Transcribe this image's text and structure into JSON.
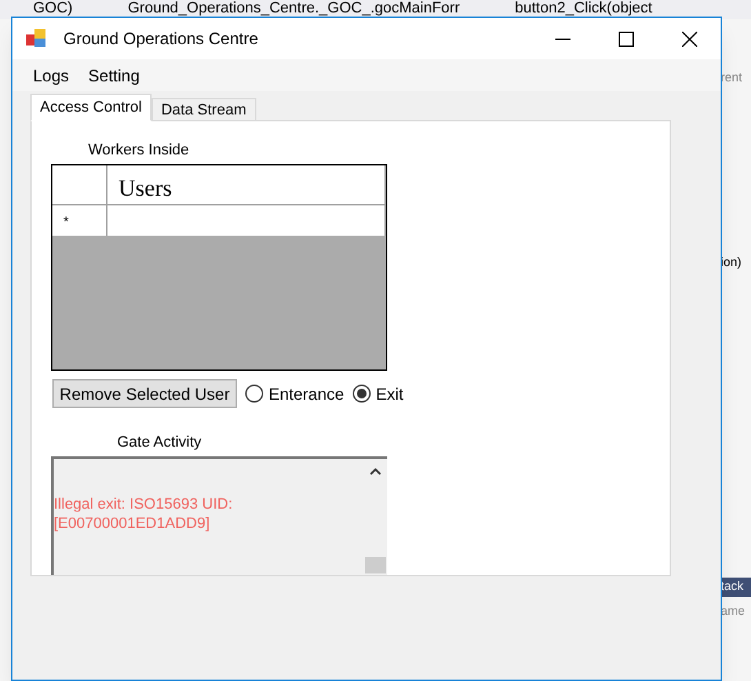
{
  "background_editor": {
    "tabs": [
      "GOC)",
      "Ground_Operations_Centre._GOC_.gocMainForr",
      "button2_Click(object"
    ],
    "right_fragments": [
      "rent",
      "ion)",
      "tack",
      "ame"
    ]
  },
  "window": {
    "title": "Ground Operations Centre"
  },
  "menu": [
    "Logs",
    "Setting"
  ],
  "tabs": [
    {
      "label": "Access Control",
      "selected": true
    },
    {
      "label": "Data Stream",
      "selected": false
    }
  ],
  "workers": {
    "label": "Workers Inside",
    "column": "Users",
    "new_row_marker": "*"
  },
  "remove_button": "Remove Selected User",
  "direction": [
    {
      "label": "Enterance",
      "selected": false
    },
    {
      "label": "Exit",
      "selected": true
    }
  ],
  "gate_activity": {
    "label": "Gate Activity",
    "log": "Illegal exit: ISO15693 UID: [E00700001ED1ADD9]"
  }
}
